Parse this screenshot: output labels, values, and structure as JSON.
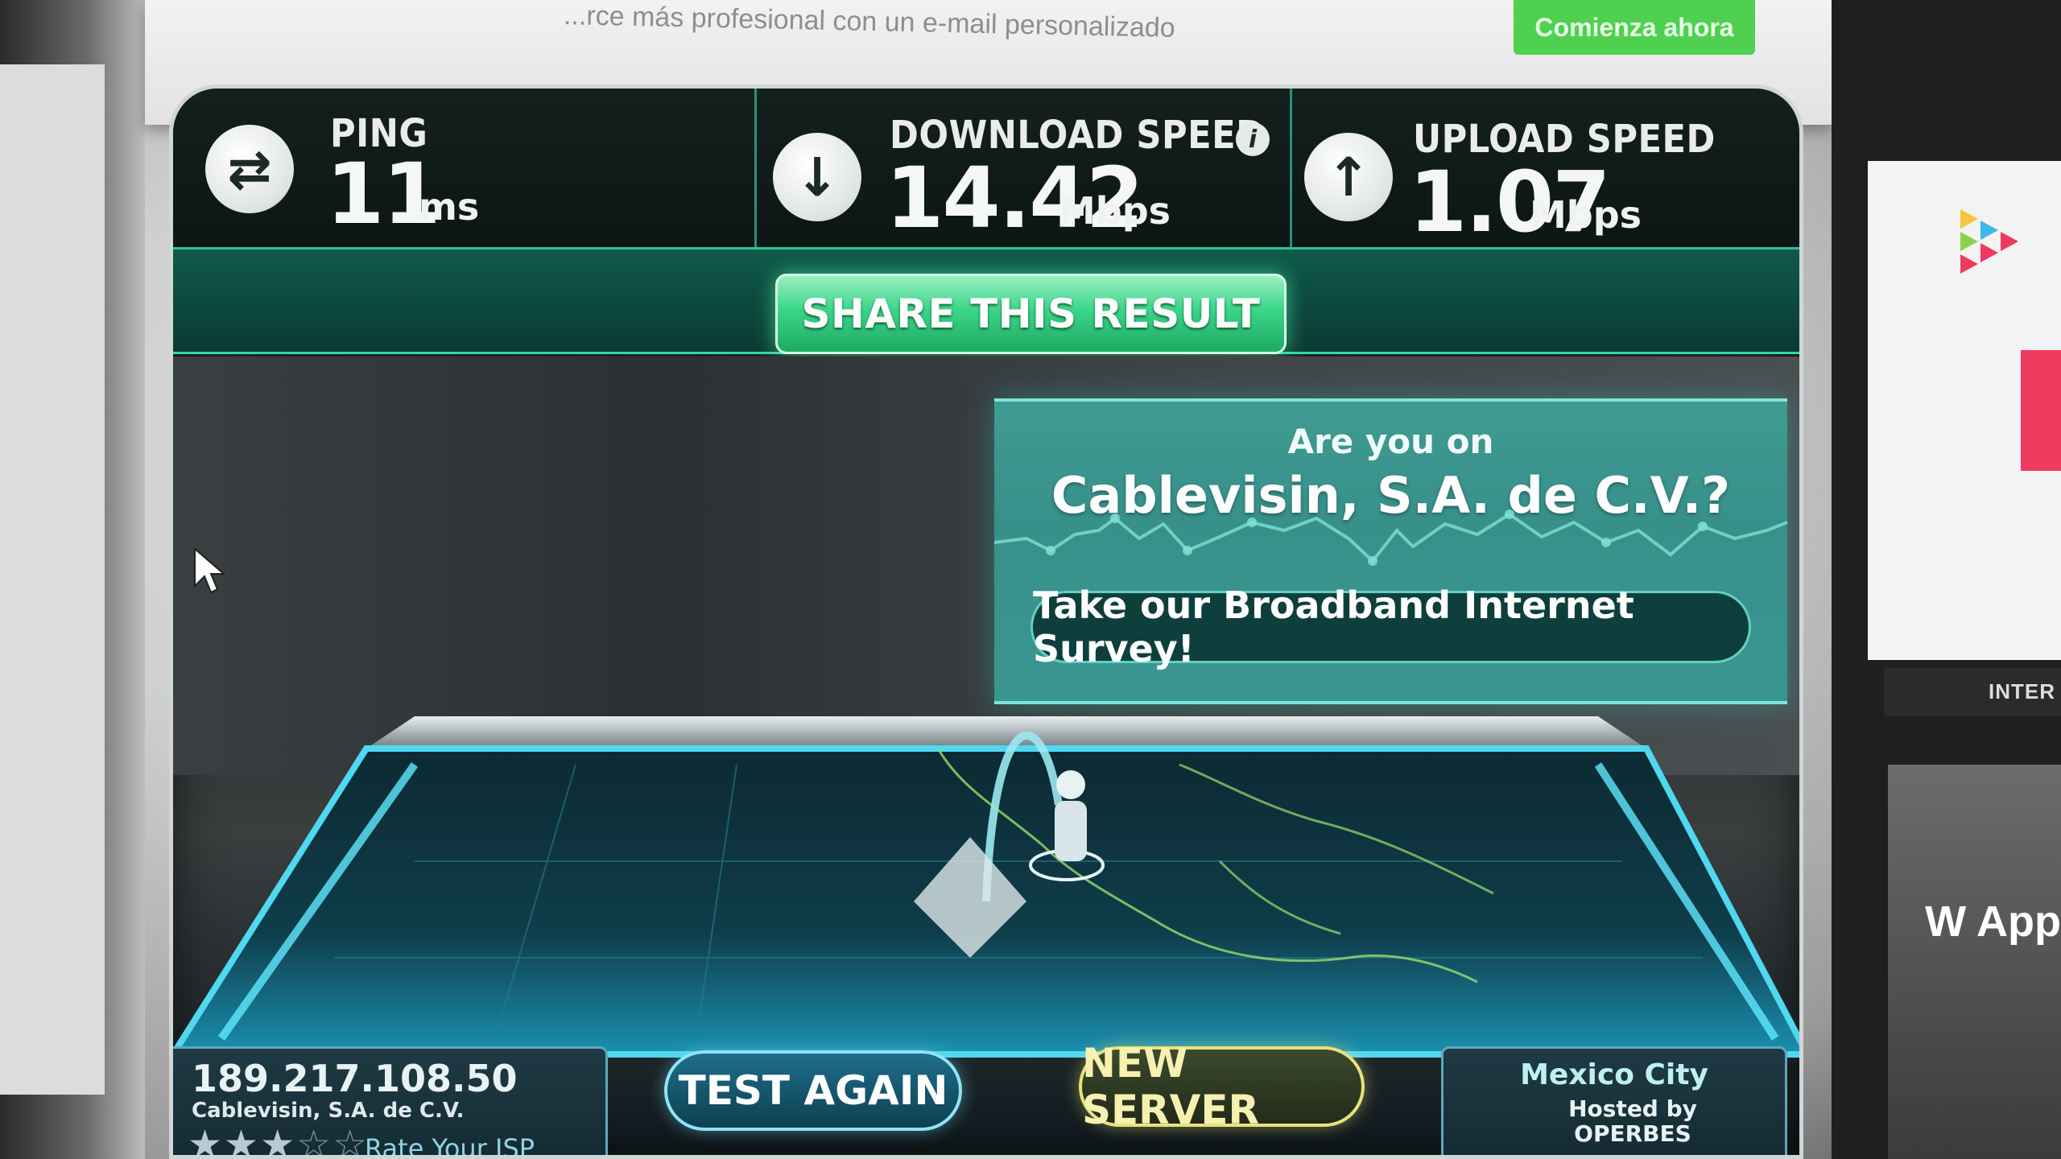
{
  "ad_banner": {
    "text": "...rce más profesional con un e-mail personalizado",
    "button": "Comienza ahora"
  },
  "results": {
    "ping": {
      "label": "PING",
      "value": "11",
      "unit": "ms"
    },
    "download": {
      "label": "DOWNLOAD SPEED",
      "value": "14.42",
      "unit": "Mbps",
      "info": "i"
    },
    "upload": {
      "label": "UPLOAD SPEED",
      "value": "1.07",
      "unit": "Mbps"
    }
  },
  "share_button": "SHARE THIS RESULT",
  "survey": {
    "question_line1": "Are you on",
    "question_line2": "Cablevisin, S.A. de C.V.?",
    "button": "Take our Broadband Internet Survey!"
  },
  "client": {
    "ip": "189.217.108.50",
    "isp": "Cablevisin, S.A. de C.V.",
    "rating_filled": 3,
    "rating_total": 5,
    "rate_link": "Rate Your ISP"
  },
  "buttons": {
    "test_again": "TEST AGAIN",
    "new_server": "NEW SERVER"
  },
  "server": {
    "city": "Mexico City",
    "hosted_by": "Hosted by OPERBES"
  },
  "right_sidebar": {
    "strip_text": "INTER",
    "ad_text": "W App"
  },
  "colors": {
    "accent_green": "#3ad68a",
    "accent_teal": "#3f9b92",
    "accent_yellow": "#e8e27a",
    "accent_blue": "#8fe4f7"
  }
}
